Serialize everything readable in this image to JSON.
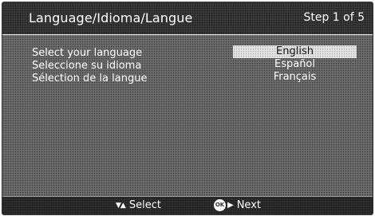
{
  "header": {
    "title": "Language/Idioma/Langue",
    "step": "Step 1 of 5"
  },
  "prompts": [
    "Select your language",
    "Seleccione su idioma",
    "Sélection de la langue"
  ],
  "options": [
    {
      "label": "English",
      "selected": true
    },
    {
      "label": "Español",
      "selected": false
    },
    {
      "label": "Français",
      "selected": false
    }
  ],
  "footer": {
    "select_icon": "down-up-arrows-icon",
    "select_label": "Select",
    "ok_icon": "ok-button-icon",
    "ok_text": "OK",
    "next_icon": "right-arrow-icon",
    "next_label": "Next"
  }
}
